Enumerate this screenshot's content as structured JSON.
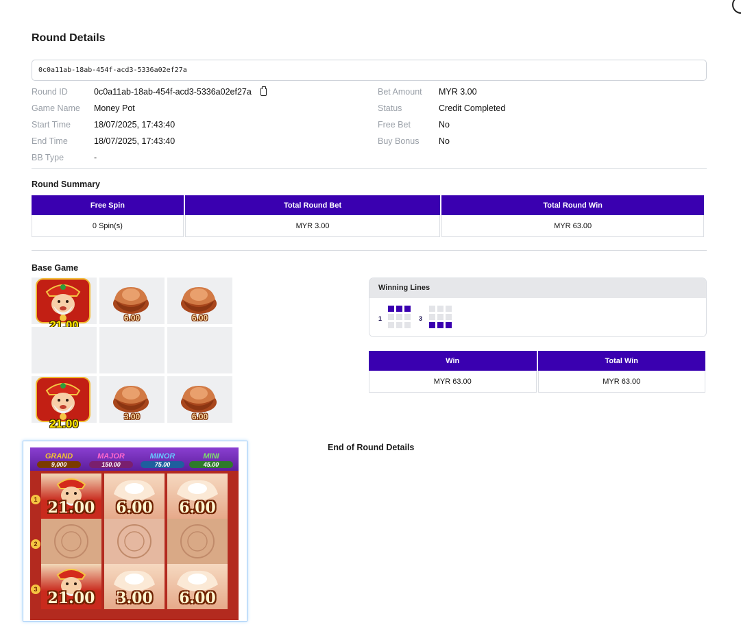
{
  "page": {
    "title": "Round Details",
    "search_value": "0c0a11ab-18ab-454f-acd3-5336a02ef27a"
  },
  "details_left": [
    {
      "label": "Round ID",
      "value": "0c0a11ab-18ab-454f-acd3-5336a02ef27a"
    },
    {
      "label": "Game Name",
      "value": "Money Pot"
    },
    {
      "label": "Start Time",
      "value": "18/07/2025, 17:43:40"
    },
    {
      "label": "End Time",
      "value": "18/07/2025, 17:43:40"
    },
    {
      "label": "BB Type",
      "value": "-"
    }
  ],
  "details_right": [
    {
      "label": "Bet Amount",
      "value": "MYR 3.00"
    },
    {
      "label": "Status",
      "value": "Credit Completed"
    },
    {
      "label": "Free Bet",
      "value": "No"
    },
    {
      "label": "Buy Bonus",
      "value": "No"
    }
  ],
  "summary": {
    "title": "Round Summary",
    "headers": [
      "Free Spin",
      "Total Round Bet",
      "Total Round Win"
    ],
    "values": [
      "0 Spin(s)",
      "MYR 3.00",
      "MYR 63.00"
    ]
  },
  "base_game": {
    "title": "Base Game",
    "reels": [
      [
        "god-of-wealth",
        "gold-ingot",
        "gold-ingot"
      ],
      [
        "empty",
        "empty",
        "empty"
      ],
      [
        "god-of-wealth",
        "gold-ingot",
        "gold-ingot"
      ]
    ],
    "cell_values": [
      [
        "21.00",
        "6.00",
        "6.00"
      ],
      [
        "",
        "",
        ""
      ],
      [
        "21.00",
        "3.00",
        "6.00"
      ]
    ]
  },
  "winning_lines": {
    "title": "Winning Lines",
    "lines": [
      {
        "number": "1",
        "row": 0
      },
      {
        "number": "3",
        "row": 2
      }
    ]
  },
  "win_table": {
    "headers": [
      "Win",
      "Total Win"
    ],
    "values": [
      "MYR 63.00",
      "MYR 63.00"
    ]
  },
  "end_text": "End of Round Details",
  "game_screenshot": {
    "jackpots": [
      {
        "label": "GRAND",
        "value": "9,000",
        "color": "#f4c430"
      },
      {
        "label": "MAJOR",
        "value": "150.00",
        "color": "#ff66cc"
      },
      {
        "label": "MINOR",
        "value": "75.00",
        "color": "#66c7ff"
      },
      {
        "label": "MINI",
        "value": "45.00",
        "color": "#7de36a"
      }
    ],
    "line_markers": [
      "1",
      "2",
      "3"
    ]
  },
  "colors": {
    "accent": "#3a00b0",
    "label_gray": "#9aa0a8"
  }
}
